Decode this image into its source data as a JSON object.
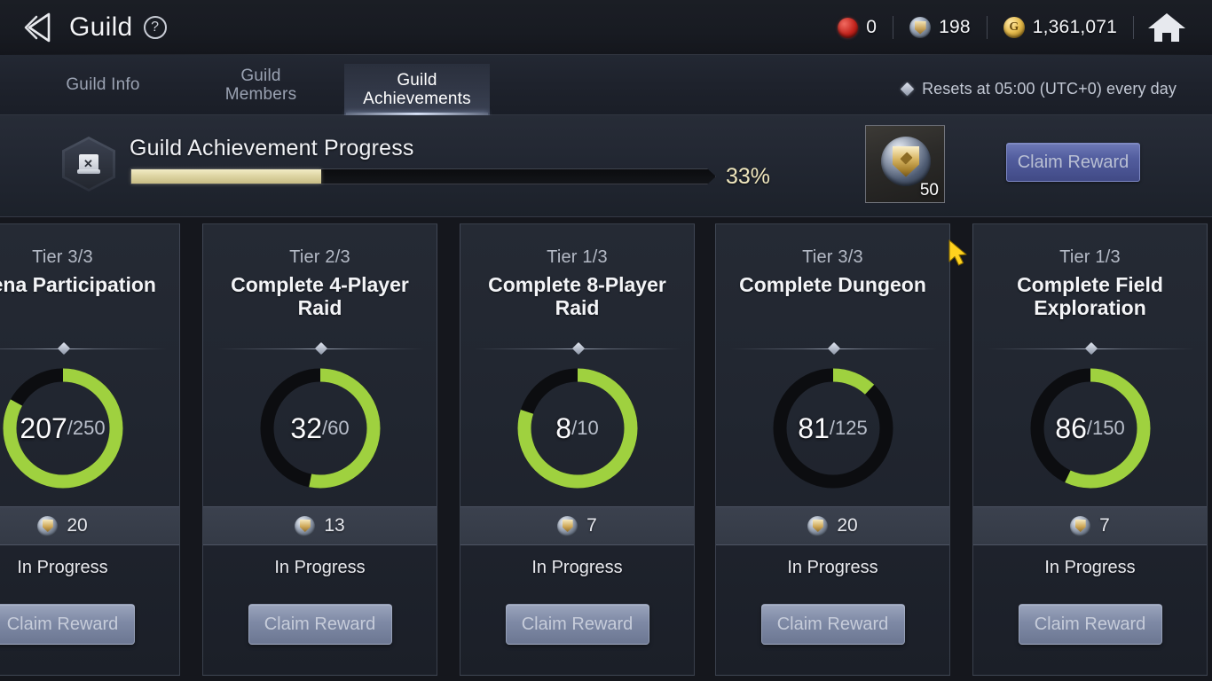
{
  "header": {
    "title": "Guild",
    "help_label": "?",
    "back_icon": "back-arrow-icon",
    "home_icon": "home-icon",
    "currencies": [
      {
        "icon": "red-orb-icon",
        "value": "0"
      },
      {
        "icon": "guild-medal-icon",
        "value": "198"
      },
      {
        "icon": "gold-coin-icon",
        "value": "1,361,071"
      }
    ]
  },
  "tabs": [
    {
      "label": "Guild Info",
      "active": false
    },
    {
      "label": "Guild\nMembers",
      "active": false
    },
    {
      "label": "Guild\nAchievements",
      "active": true
    }
  ],
  "reset_note": "Resets at 05:00 (UTC+0) every day",
  "progress": {
    "icon": "guild-scroll-icon",
    "label": "Guild Achievement Progress",
    "percent_label": "33%",
    "percent": 33,
    "reward": {
      "icon": "guild-medal-icon",
      "quantity": "50"
    },
    "claim_label": "Claim Reward"
  },
  "colors": {
    "ring_fill": "#9fd13f",
    "ring_track": "#0c0d10",
    "bar_fill": "#ded5a4",
    "accent_blue": "#525d9e",
    "panel_bg": "#232834"
  },
  "cards": [
    {
      "tier": "Tier 3/3",
      "title": "Arena Participation",
      "value": "207",
      "max": "/250",
      "percent": 83,
      "reward_amount": "20",
      "reward_icon": "guild-medal-icon",
      "status": "In Progress",
      "claim_label": "Claim Reward"
    },
    {
      "tier": "Tier 2/3",
      "title": "Complete 4-Player\nRaid",
      "value": "32",
      "max": "/60",
      "percent": 53,
      "reward_amount": "13",
      "reward_icon": "guild-medal-icon",
      "status": "In Progress",
      "claim_label": "Claim Reward"
    },
    {
      "tier": "Tier 1/3",
      "title": "Complete 8-Player\nRaid",
      "value": "8",
      "max": "/10",
      "percent": 80,
      "reward_amount": "7",
      "reward_icon": "guild-medal-icon",
      "status": "In Progress",
      "claim_label": "Claim Reward"
    },
    {
      "tier": "Tier 3/3",
      "title": "Complete Dungeon",
      "value": "81",
      "max": "/125",
      "percent": 12,
      "reward_amount": "20",
      "reward_icon": "guild-medal-icon",
      "status": "In Progress",
      "claim_label": "Claim Reward"
    },
    {
      "tier": "Tier 1/3",
      "title": "Complete Field\nExploration",
      "value": "86",
      "max": "/150",
      "percent": 57,
      "reward_amount": "7",
      "reward_icon": "guild-medal-icon",
      "status": "In Progress",
      "claim_label": "Claim Reward"
    }
  ],
  "cursor": {
    "icon": "mouse-cursor-icon"
  }
}
